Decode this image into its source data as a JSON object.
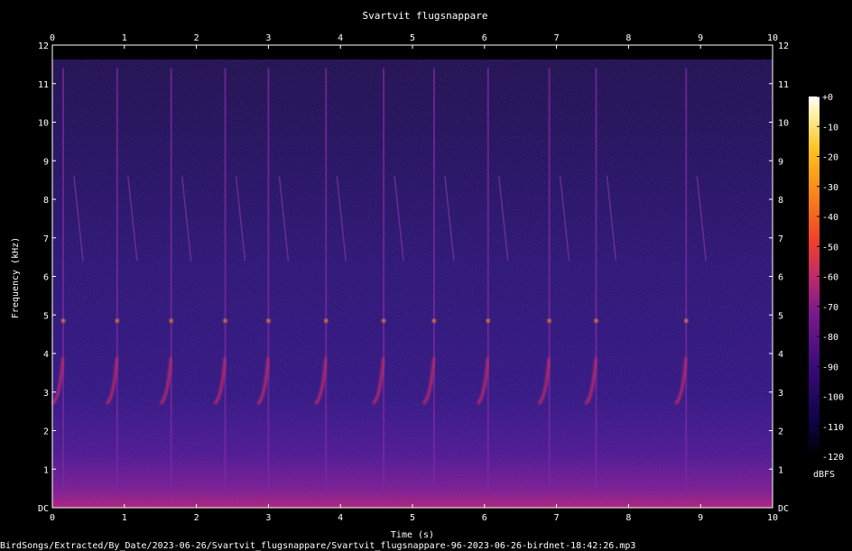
{
  "chart_data": {
    "type": "heatmap",
    "title": "Svartvit flugsnappare",
    "xlabel": "Time (s)",
    "ylabel": "Frequency (kHz)",
    "xlim": [
      0,
      10
    ],
    "ylim": [
      0,
      12
    ],
    "x_ticks": [
      "0",
      "1",
      "2",
      "3",
      "4",
      "5",
      "6",
      "7",
      "8",
      "9",
      "10"
    ],
    "y_ticks": [
      "DC",
      "1",
      "2",
      "3",
      "4",
      "5",
      "6",
      "7",
      "8",
      "9",
      "10",
      "11",
      "12"
    ],
    "colorbar": {
      "label": "dBFS",
      "range": [
        -120,
        0
      ],
      "ticks": [
        "+0",
        "-10",
        "-20",
        "-30",
        "-40",
        "-50",
        "-60",
        "-70",
        "-80",
        "-90",
        "-100",
        "-110",
        "-120"
      ],
      "colors": [
        "#000000",
        "#0d0545",
        "#3a0a7a",
        "#7a1a8a",
        "#c02a6a",
        "#f0402a",
        "#f8801a",
        "#fcc020",
        "#fff0a0",
        "#ffffff"
      ]
    },
    "calls_time_s": [
      0.15,
      0.9,
      1.65,
      2.4,
      3.0,
      3.8,
      4.6,
      5.3,
      6.05,
      6.9,
      7.55,
      8.8
    ],
    "call_band_khz": [
      2.7,
      6.0
    ],
    "noise_floor_khz": [
      0,
      1.2
    ],
    "signal_cutoff_khz": 11.5
  },
  "footer": "BirdSongs/Extracted/By_Date/2023-06-26/Svartvit_flugsnappare/Svartvit_flugsnappare-96-2023-06-26-birdnet-18:42:26.mp3"
}
